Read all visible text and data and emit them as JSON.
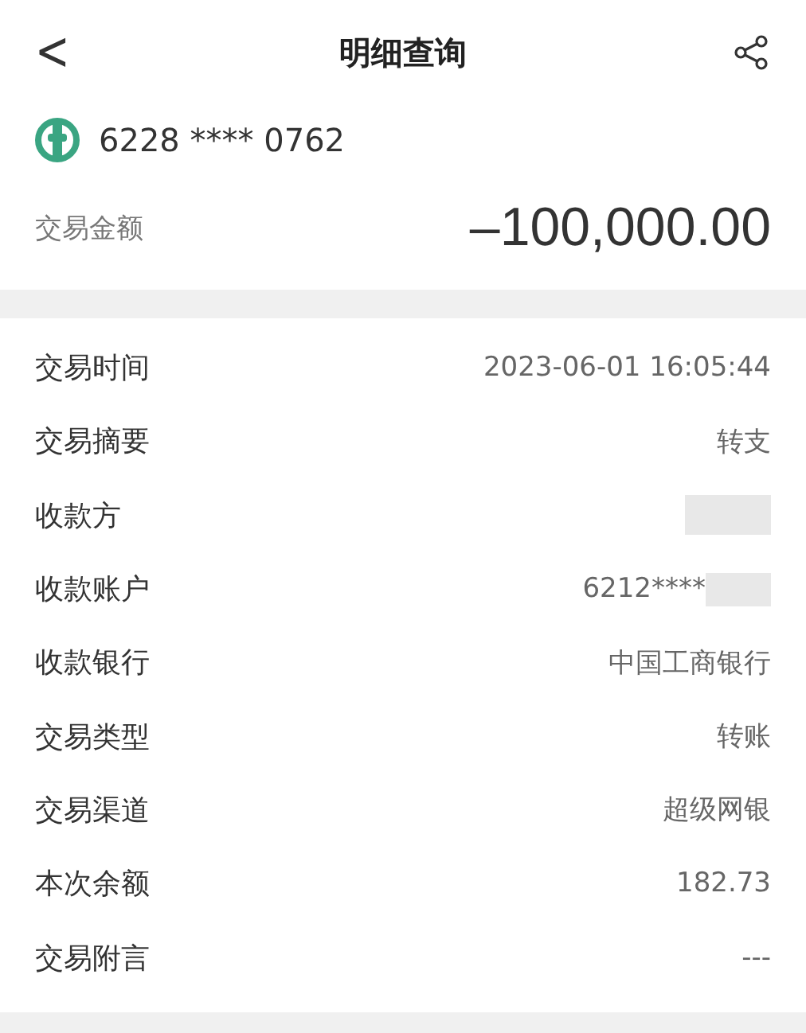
{
  "header": {
    "back": "<",
    "title": "明细查询"
  },
  "summary": {
    "card_number": "6228 **** 0762",
    "amount_label": "交易金额",
    "amount": "–100,000.00"
  },
  "details": [
    {
      "label": "交易时间",
      "value": "2023-06-01 16:05:44",
      "masked": false
    },
    {
      "label": "交易摘要",
      "value": "转支",
      "masked": false
    },
    {
      "label": "收款方",
      "masked": true
    },
    {
      "label": "收款账户",
      "value": "6212****",
      "masked": true
    },
    {
      "label": "收款银行",
      "value": "中国工商银行",
      "masked": false
    },
    {
      "label": "交易类型",
      "value": "转账",
      "masked": false
    },
    {
      "label": "交易渠道",
      "value": "超级网银",
      "masked": false
    },
    {
      "label": "本次余额",
      "value": "182.73",
      "masked": false
    },
    {
      "label": "交易附言",
      "value": "---",
      "masked": false
    }
  ]
}
